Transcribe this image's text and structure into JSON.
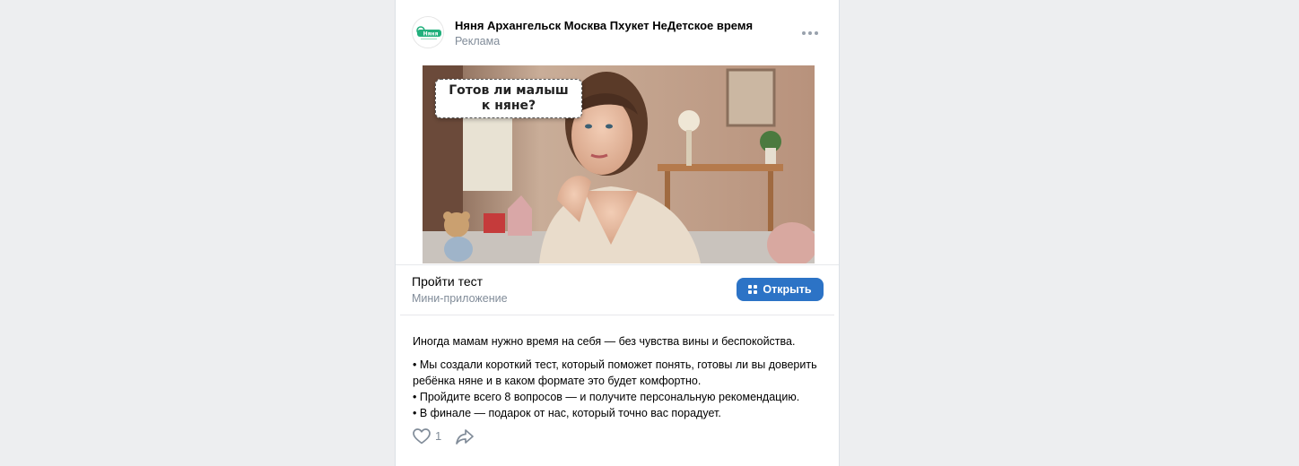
{
  "post": {
    "community_name": "Няня Архангельск Москва Пхукет НеДетское время",
    "label": "Реклама",
    "avatar_logo_text": "Няня",
    "image_caption_line1": "Готов ли малыш",
    "image_caption_line2": "к няне?"
  },
  "cta": {
    "title": "Пройти тест",
    "subtitle": "Мини-приложение",
    "button_label": "Открыть"
  },
  "text": {
    "intro": "Иногда мамам нужно время на себя — без чувства вины и беспокойства.",
    "bullet1": "• Мы создали короткий тест, который поможет понять, готовы ли вы доверить ребёнка няне и в каком формате это будет комфортно.",
    "bullet2": "• Пройдите всего 8 вопросов — и получите персональную рекомендацию.",
    "bullet3": "• В финале — подарок от нас, который точно вас порадует."
  },
  "actions": {
    "like_count": "1"
  },
  "icons": {
    "more": "more-horizontal-icon",
    "open": "apps-grid-icon",
    "like": "heart-icon",
    "share": "share-arrow-icon"
  },
  "colors": {
    "accent": "#2c73c6",
    "secondary_text": "#818c99",
    "page_bg": "#edeef0"
  }
}
